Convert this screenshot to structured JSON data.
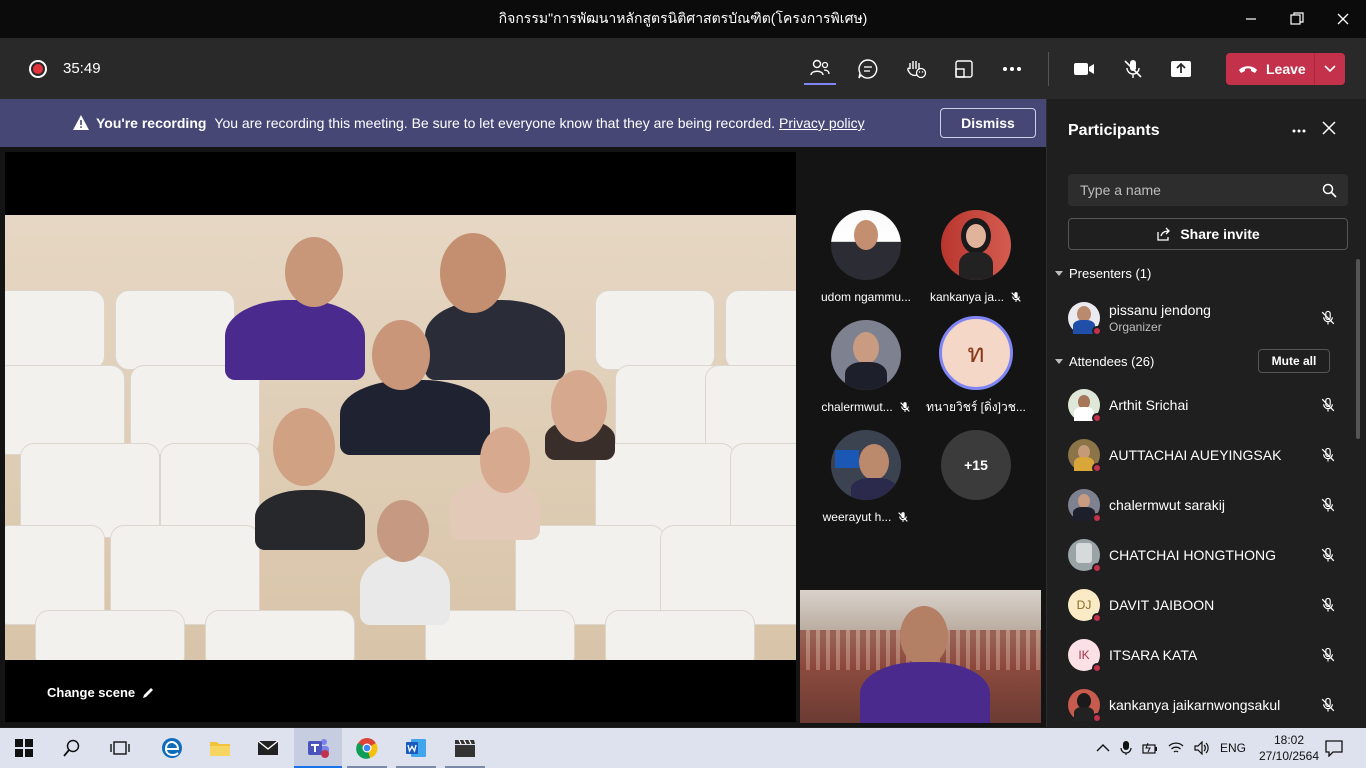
{
  "window": {
    "title": "กิจกรรม\"การพัฒนาหลักสูตรนิติศาสตรบัณฑิต(โครงการพิเศษ)"
  },
  "meeting": {
    "timer": "35:49",
    "leave_label": "Leave"
  },
  "banner": {
    "title": "You're recording",
    "message": "You are recording this meeting. Be sure to let everyone know that they are being recorded.",
    "link": "Privacy policy",
    "dismiss": "Dismiss"
  },
  "stage": {
    "change_scene": "Change scene",
    "tiles": [
      {
        "name": "udom ngammu..."
      },
      {
        "name": "kankanya ja..."
      },
      {
        "name": "chalermwut..."
      },
      {
        "name": "ทนายวิชร์ [ดิ่ง]วช...",
        "initial": "ท"
      },
      {
        "name": "weerayut h..."
      }
    ],
    "overflow": "+15"
  },
  "participants": {
    "title": "Participants",
    "search_placeholder": "Type a name",
    "share_invite": "Share invite",
    "presenters_label": "Presenters (1)",
    "attendees_label": "Attendees (26)",
    "mute_all": "Mute all",
    "presenters": [
      {
        "name": "pissanu jendong",
        "role": "Organizer"
      }
    ],
    "attendees": [
      {
        "name": "Arthit Srichai"
      },
      {
        "name": "AUTTACHAI AUEYINGSAK"
      },
      {
        "name": "chalermwut sarakij"
      },
      {
        "name": "CHATCHAI HONGTHONG"
      },
      {
        "name": "DAVIT JAIBOON",
        "initials": "DJ"
      },
      {
        "name": "ITSARA KATA",
        "initials": "IK"
      },
      {
        "name": "kankanya jaikarnwongsakul"
      }
    ]
  },
  "taskbar": {
    "language": "ENG",
    "time": "18:02",
    "date": "27/10/2564"
  },
  "colors": {
    "accent": "#7f85f5",
    "leave": "#c4314b",
    "banner": "#464775"
  }
}
